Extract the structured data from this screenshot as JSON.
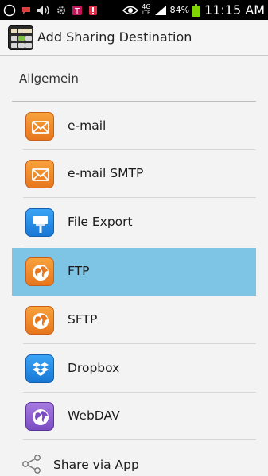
{
  "status_bar": {
    "network": "4G",
    "network_sub": "LTE",
    "battery_percent": "84%",
    "time": "11:15 AM"
  },
  "action_bar": {
    "title": "Add Sharing Destination"
  },
  "section": {
    "title": "Allgemein"
  },
  "destinations": [
    {
      "label": "e-mail",
      "icon": "mail-icon",
      "color": "#f08a2c"
    },
    {
      "label": "e-mail SMTP",
      "icon": "mail-icon",
      "color": "#f08a2c"
    },
    {
      "label": "File Export",
      "icon": "file-export-icon",
      "color": "#2a8ee8"
    },
    {
      "label": "FTP",
      "icon": "globe-icon",
      "color": "#f08a2c",
      "selected": true
    },
    {
      "label": "SFTP",
      "icon": "globe-icon",
      "color": "#f08a2c"
    },
    {
      "label": "Dropbox",
      "icon": "dropbox-icon",
      "color": "#2a8ee8"
    },
    {
      "label": "WebDAV",
      "icon": "globe-icon",
      "color": "#8f62d6"
    }
  ],
  "share": {
    "label": "Share via App",
    "icon": "share-icon"
  },
  "colors": {
    "selected_row": "#7ec5e5",
    "status_bar": "#000000",
    "battery": "#7fd600"
  }
}
